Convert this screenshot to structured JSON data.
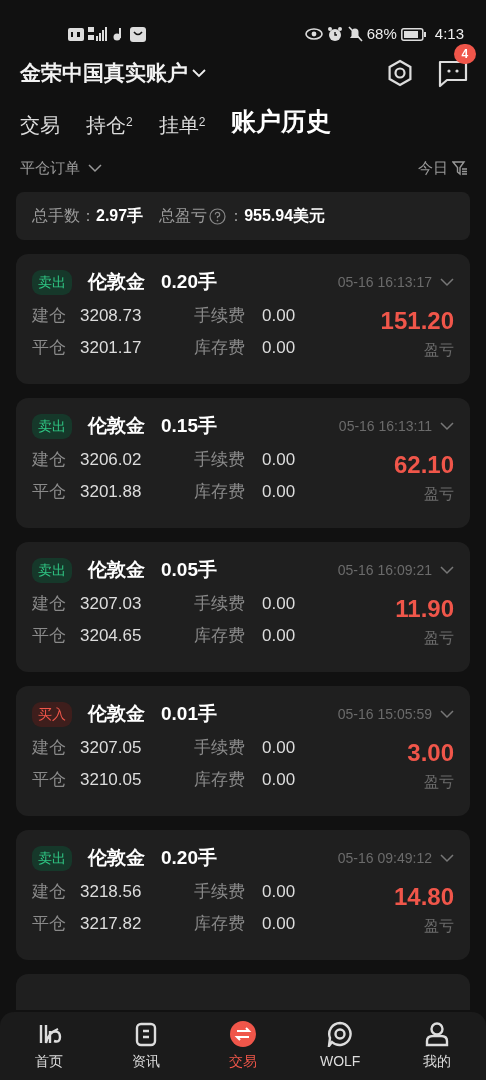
{
  "status_bar": {
    "battery": "68%",
    "time": "4:13"
  },
  "header": {
    "account": "金荣中国真实账户",
    "message_badge": "4"
  },
  "tabs": [
    {
      "label": "交易",
      "selected": false
    },
    {
      "label": "持仓",
      "sup": "2",
      "selected": false
    },
    {
      "label": "挂单",
      "sup": "2",
      "selected": false
    },
    {
      "label": "账户历史",
      "selected": true
    }
  ],
  "filter": {
    "order_type": "平仓订单",
    "date": "今日"
  },
  "summary": {
    "lots_label": "总手数：",
    "lots": "2.97手",
    "pnl_label": "总盈亏",
    "pnl_sep": "：",
    "pnl": "955.94美元"
  },
  "orders": [
    {
      "kind": "sell",
      "side_label": "卖出",
      "symbol": "伦敦金",
      "lots": "0.20手",
      "time": "05-16 16:13:17",
      "open_label": "建仓",
      "open": "3208.73",
      "fee_label": "手续费",
      "fee": "0.00",
      "close_label": "平仓",
      "close": "3201.17",
      "swap_label": "库存费",
      "swap": "0.00",
      "pnl": "151.20",
      "pnl_label": "盈亏"
    },
    {
      "kind": "sell",
      "side_label": "卖出",
      "symbol": "伦敦金",
      "lots": "0.15手",
      "time": "05-16 16:13:11",
      "open_label": "建仓",
      "open": "3206.02",
      "fee_label": "手续费",
      "fee": "0.00",
      "close_label": "平仓",
      "close": "3201.88",
      "swap_label": "库存费",
      "swap": "0.00",
      "pnl": "62.10",
      "pnl_label": "盈亏"
    },
    {
      "kind": "sell",
      "side_label": "卖出",
      "symbol": "伦敦金",
      "lots": "0.05手",
      "time": "05-16 16:09:21",
      "open_label": "建仓",
      "open": "3207.03",
      "fee_label": "手续费",
      "fee": "0.00",
      "close_label": "平仓",
      "close": "3204.65",
      "swap_label": "库存费",
      "swap": "0.00",
      "pnl": "11.90",
      "pnl_label": "盈亏"
    },
    {
      "kind": "buy",
      "side_label": "买入",
      "symbol": "伦敦金",
      "lots": "0.01手",
      "time": "05-16 15:05:59",
      "open_label": "建仓",
      "open": "3207.05",
      "fee_label": "手续费",
      "fee": "0.00",
      "close_label": "平仓",
      "close": "3210.05",
      "swap_label": "库存费",
      "swap": "0.00",
      "pnl": "3.00",
      "pnl_label": "盈亏"
    },
    {
      "kind": "sell",
      "side_label": "卖出",
      "symbol": "伦敦金",
      "lots": "0.20手",
      "time": "05-16 09:49:12",
      "open_label": "建仓",
      "open": "3218.56",
      "fee_label": "手续费",
      "fee": "0.00",
      "close_label": "平仓",
      "close": "3217.82",
      "swap_label": "库存费",
      "swap": "0.00",
      "pnl": "14.80",
      "pnl_label": "盈亏"
    }
  ],
  "bottom_nav": [
    {
      "label": "首页",
      "selected": false
    },
    {
      "label": "资讯",
      "selected": false
    },
    {
      "label": "交易",
      "selected": true
    },
    {
      "label": "WOLF",
      "selected": false
    },
    {
      "label": "我的",
      "selected": false
    }
  ]
}
